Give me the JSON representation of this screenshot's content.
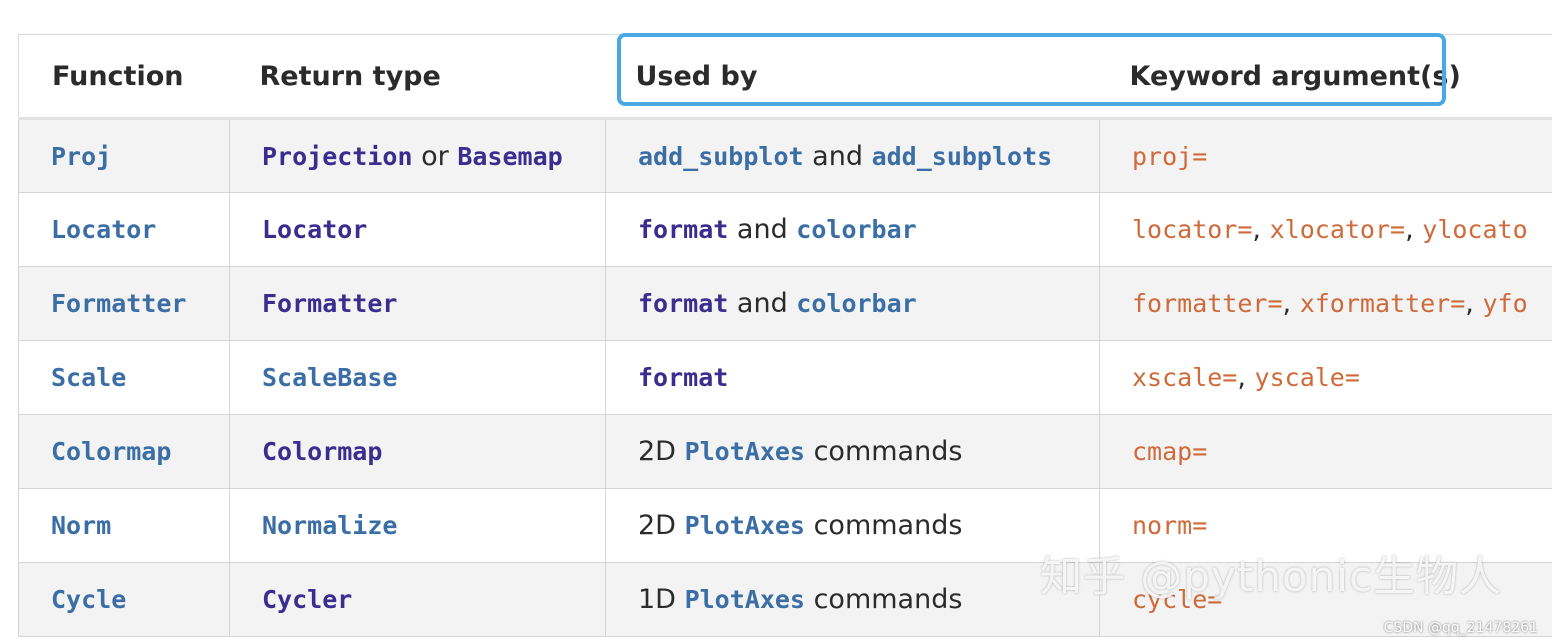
{
  "header": {
    "function": "Function",
    "return_type": "Return type",
    "used_by": "Used by",
    "keyword_args": "Keyword argument(s)"
  },
  "rows": [
    {
      "function": "Proj",
      "return_a": "Projection",
      "return_or": "or",
      "return_b": "Basemap",
      "used_a": "add_subplot",
      "used_and": "and",
      "used_b": "add_subplots",
      "kw1": "proj="
    },
    {
      "function": "Locator",
      "return": "Locator",
      "used_a": "format",
      "used_and": "and",
      "used_b": "colorbar",
      "kw1": "locator=",
      "kw2": "xlocator=",
      "kw3": "ylocato"
    },
    {
      "function": "Formatter",
      "return": "Formatter",
      "used_a": "format",
      "used_and": "and",
      "used_b": "colorbar",
      "kw1": "formatter=",
      "kw2": "xformatter=",
      "kw3": "yfo"
    },
    {
      "function": "Scale",
      "return": "ScaleBase",
      "used_a": "format",
      "kw1": "xscale=",
      "kw2": "yscale="
    },
    {
      "function": "Colormap",
      "return": "Colormap",
      "used_pre": "2D",
      "used_code": "PlotAxes",
      "used_post": "commands",
      "kw1": "cmap="
    },
    {
      "function": "Norm",
      "return": "Normalize",
      "used_pre": "2D",
      "used_code": "PlotAxes",
      "used_post": "commands",
      "kw1": "norm="
    },
    {
      "function": "Cycle",
      "return": "Cycler",
      "used_pre": "1D",
      "used_code": "PlotAxes",
      "used_post": "commands",
      "kw1": "cycle="
    }
  ],
  "separator": ",",
  "watermark": "知乎 @pythonic生物人",
  "credit": "CSDN @qq_21478261"
}
